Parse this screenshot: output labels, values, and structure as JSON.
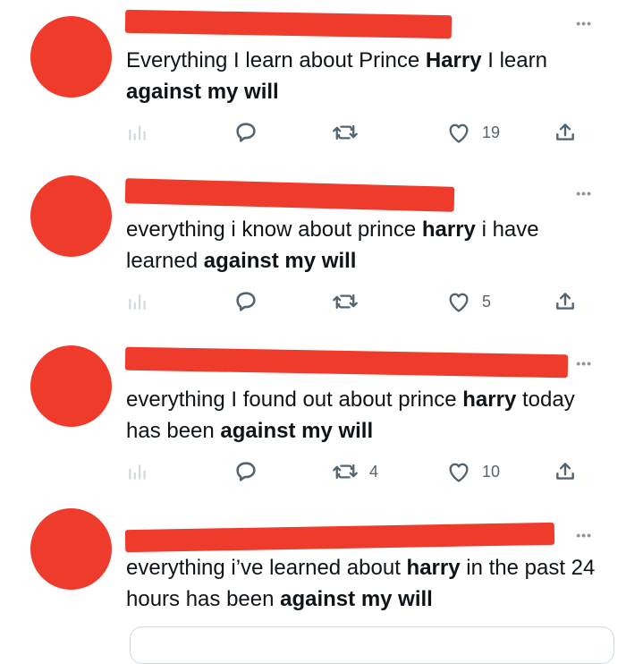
{
  "colors": {
    "redaction": "#ef3b2c",
    "icon": "#536471",
    "divider": "#d9dde1"
  },
  "tweets": [
    {
      "more_label": "•••",
      "segments": [
        "Everything I learn about Prince ",
        "Harry",
        " I learn ",
        "against my will",
        ""
      ],
      "stats": {
        "replies": "",
        "retweets": "",
        "likes": "19"
      }
    },
    {
      "more_label": "•••",
      "segments": [
        "everything i know about prince ",
        "harry",
        " i have learned ",
        "against my will",
        ""
      ],
      "stats": {
        "replies": "",
        "retweets": "",
        "likes": "5"
      }
    },
    {
      "more_label": "•••",
      "segments": [
        "everything I found out about prince ",
        "harry",
        " today has been ",
        "against my will",
        ""
      ],
      "stats": {
        "replies": "",
        "retweets": "4",
        "likes": "10"
      }
    },
    {
      "more_label": "•••",
      "segments": [
        "everything i’ve learned about ",
        "harry",
        " in the past 24 hours has been ",
        "against my will",
        ""
      ]
    }
  ],
  "icons": {
    "analytics": "analytics-icon",
    "reply": "reply-icon",
    "retweet": "retweet-icon",
    "like": "heart-icon",
    "share": "share-icon"
  }
}
